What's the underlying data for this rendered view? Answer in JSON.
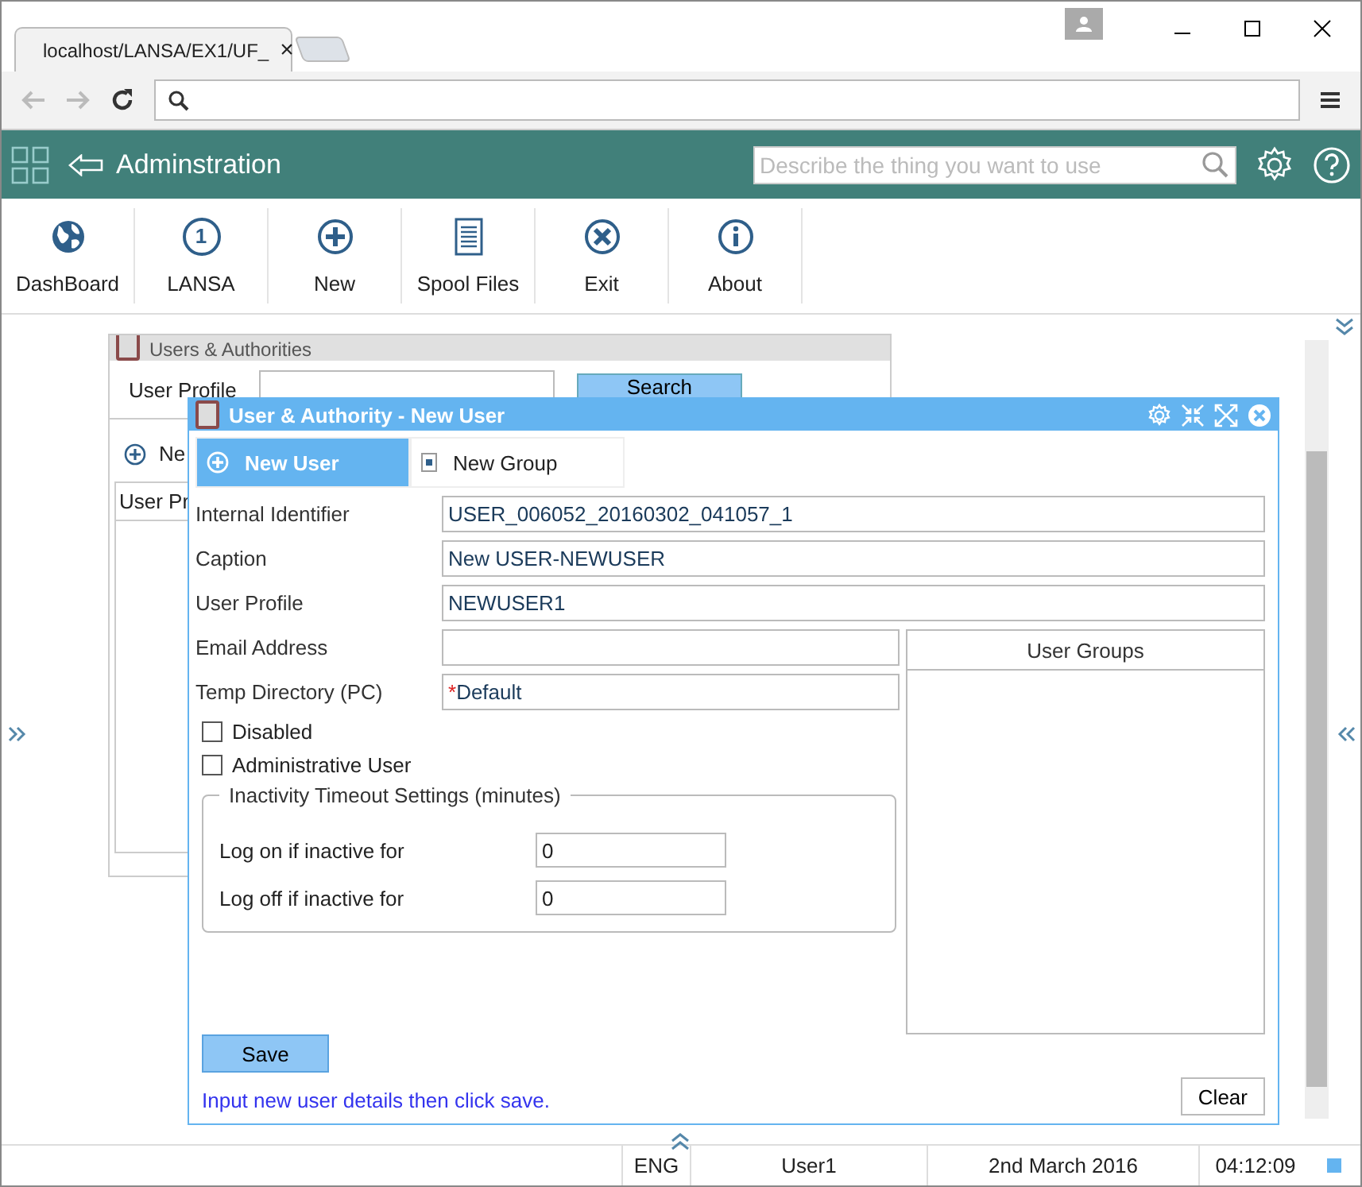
{
  "browser": {
    "tab_title": "localhost/LANSA/EX1/UF_",
    "close_glyph": "×"
  },
  "header": {
    "title": "Adminstration",
    "search_placeholder": "Describe the thing you want to use"
  },
  "toolbar": [
    {
      "kind": "globe",
      "label": "DashBoard"
    },
    {
      "kind": "number",
      "glyph": "1",
      "label": "LANSA"
    },
    {
      "kind": "plus",
      "label": "New"
    },
    {
      "kind": "list",
      "label": "Spool Files"
    },
    {
      "kind": "exit",
      "label": "Exit"
    },
    {
      "kind": "info",
      "label": "About"
    }
  ],
  "back_panel": {
    "title": "Users & Authorities",
    "user_profile_label": "User Profile",
    "search_button": "Search",
    "new_link": "Ne",
    "column_1": "User Pr"
  },
  "dialog": {
    "title": "User & Authority - New User",
    "tabs": [
      {
        "label": "New User",
        "selected": true
      },
      {
        "label": "New Group",
        "selected": false
      }
    ],
    "fields": [
      {
        "label": "Internal Identifier",
        "value": "USER_006052_20160302_041057_1"
      },
      {
        "label": "Caption",
        "value": "New USER-NEWUSER"
      },
      {
        "label": "User Profile",
        "value": "NEWUSER1"
      }
    ],
    "side_fields": [
      {
        "label": "Email Address"
      },
      {
        "label": "Temp Directory (PC)",
        "marker": "*",
        "value": "Default"
      }
    ],
    "checkboxes": [
      {
        "label": "Disabled",
        "checked": false
      },
      {
        "label": "Administrative User",
        "checked": false
      }
    ],
    "timeout_group": {
      "title": "Inactivity Timeout Settings (minutes)",
      "rows": [
        {
          "label": "Log on if inactive for",
          "value": "0"
        },
        {
          "label": "Log off if inactive for",
          "value": "0"
        }
      ]
    },
    "user_groups": {
      "header": "User Groups"
    },
    "save_button": "Save",
    "message": "Input new user details then click save.",
    "clear_button": "Clear"
  },
  "status_bar": [
    "ENG",
    "User1",
    "2nd March 2016",
    "04:12:09"
  ]
}
